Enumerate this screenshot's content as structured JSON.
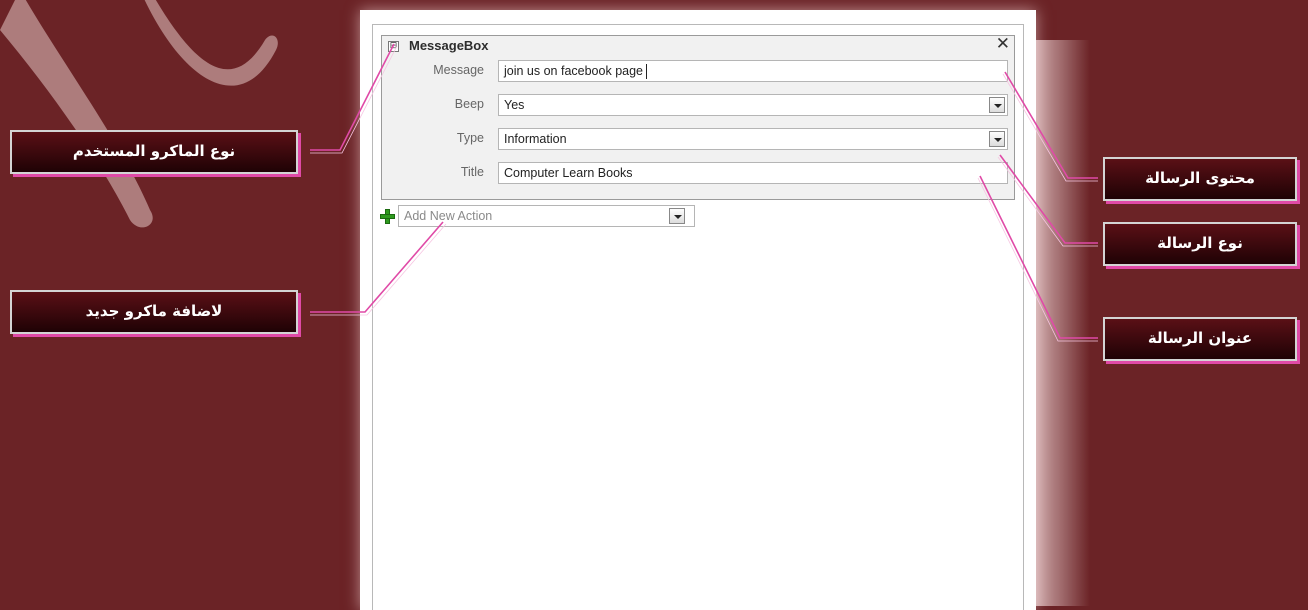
{
  "macro_designer": {
    "action": {
      "name": "MessageBox",
      "collapse_symbol": "⊟",
      "close_symbol": "✕",
      "arguments": [
        {
          "label": "Message",
          "value": "join us on facebook page",
          "type": "text"
        },
        {
          "label": "Beep",
          "value": "Yes",
          "type": "dropdown"
        },
        {
          "label": "Type",
          "value": "Information",
          "type": "dropdown"
        },
        {
          "label": "Title",
          "value": "Computer Learn Books",
          "type": "text"
        }
      ]
    },
    "add_new_action": {
      "placeholder": "Add New Action",
      "icon": "green-plus-icon"
    }
  },
  "callouts": {
    "action_type": "نوع الماكرو المستخدم",
    "add_macro": "لاضافة ماكرو جديد",
    "message_content": "محتوى الرسالة",
    "message_type": "نوع الرسالة",
    "message_title": "عنوان الرسالة"
  },
  "colors": {
    "background": "#6b2326",
    "callout_bg": "#2a0508",
    "callout_shadow": "#e04aa7",
    "leader_line": "#e04aa7"
  }
}
